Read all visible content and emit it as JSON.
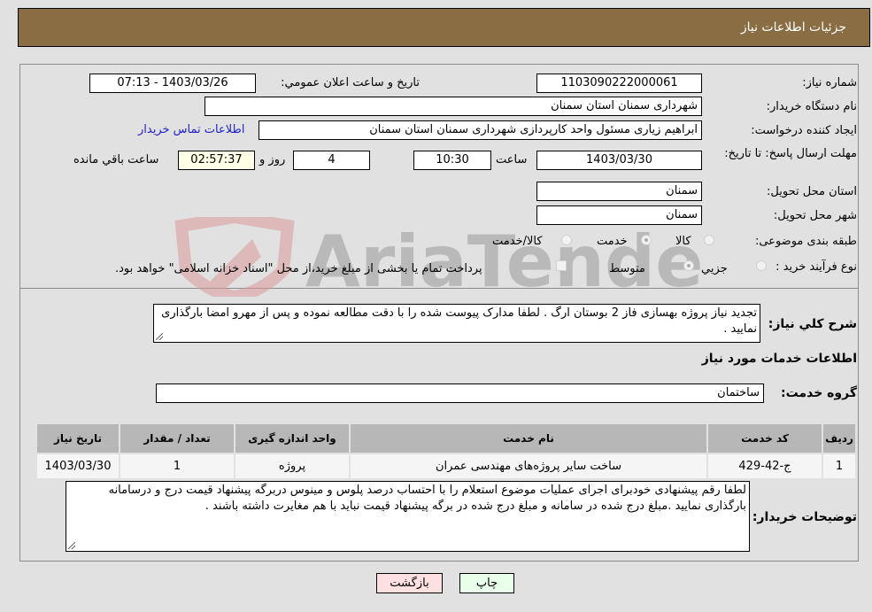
{
  "header": {
    "title": "جزئيات اطلاعات نياز"
  },
  "fields": {
    "need_number_label": "شماره نیاز:",
    "need_number": "1103090222000061",
    "announce_label": "تاريخ و ساعت اعلان عمومي:",
    "announce_value": "1403/03/26 - 07:13",
    "buyer_org_label": "نام دستگاه خریدار:",
    "buyer_org": "شهرداری سمنان استان سمنان",
    "creator_label": "ایجاد کننده درخواست:",
    "creator": "ابراهیم زیاری مسئول واحد کارپردازی شهرداری سمنان استان سمنان",
    "contact_link": "اطلاعات تماس خریدار",
    "deadline_label": "مهلت ارسال پاسخ: تا تاریخ:",
    "deadline_date": "1403/03/30",
    "time_label": "ساعت",
    "deadline_time": "10:30",
    "days_value": "4",
    "days_label": "روز و",
    "remaining_time": "02:57:37",
    "remaining_label": "ساعت باقي مانده",
    "province_label": "استان محل تحویل:",
    "province": "سمنان",
    "city_label": "شهر محل تحویل:",
    "city": "سمنان",
    "category_label": "طبقه بندی موضوعی:",
    "category_options": [
      {
        "label": "کالا",
        "checked": false
      },
      {
        "label": "خدمت",
        "checked": true
      },
      {
        "label": "کالا/خدمت",
        "checked": false
      }
    ],
    "process_label": "نوع فرآیند خرید :",
    "process_options": [
      {
        "label": "جزيي",
        "checked": false
      },
      {
        "label": "متوسط",
        "checked": true
      }
    ],
    "treasury_note": "پرداخت تمام یا بخشی از مبلغ خرید،از محل \"اسناد خزانه اسلامی\" خواهد بود."
  },
  "description": {
    "label": "شرح كلي نياز:",
    "text": "تجدید نیاز پروژه بهسازی فاز 2 بوستان ارگ . لطفا مدارک پیوست شده را با دقت مطالعه نموده و پس از مهرو امضا بارگذاری نمایید ."
  },
  "services": {
    "section_title": "اطلاعات خدمات مورد نیاز",
    "group_label": "گروه خدمت:",
    "group_value": "ساختمان",
    "columns": [
      "ردیف",
      "کد خدمت",
      "نام خدمت",
      "واحد اندازه گیری",
      "تعداد / مقدار",
      "تاریخ نیاز"
    ],
    "rows": [
      [
        "1",
        "ج-42-429",
        "ساخت سایر پروژه‌های مهندسی عمران",
        "پروژه",
        "1",
        "1403/03/30"
      ]
    ]
  },
  "buyer_notes": {
    "label": "توضیحات خریدار:",
    "text": "لطفا رقم پیشنهادی خودبرای اجرای عملیات موضوع استعلام را با احتساب درصد پلوس و مینوس دربرگه پیشنهاد قیمت درج و درسامانه بارگذاری نمایید .مبلغ درج شده در سامانه و مبلغ درج شده در برگه پیشنهاد قیمت نباید با هم مغایرت داشته باشند ."
  },
  "buttons": {
    "print": "چاپ",
    "back": "بازگشت"
  },
  "watermark": {
    "text": "AriaTender.neT"
  },
  "colors": {
    "header_bg": "#8b6d43",
    "print_bg": "#eaffea",
    "back_bg": "#ffe0e0",
    "link": "#2222cc"
  }
}
